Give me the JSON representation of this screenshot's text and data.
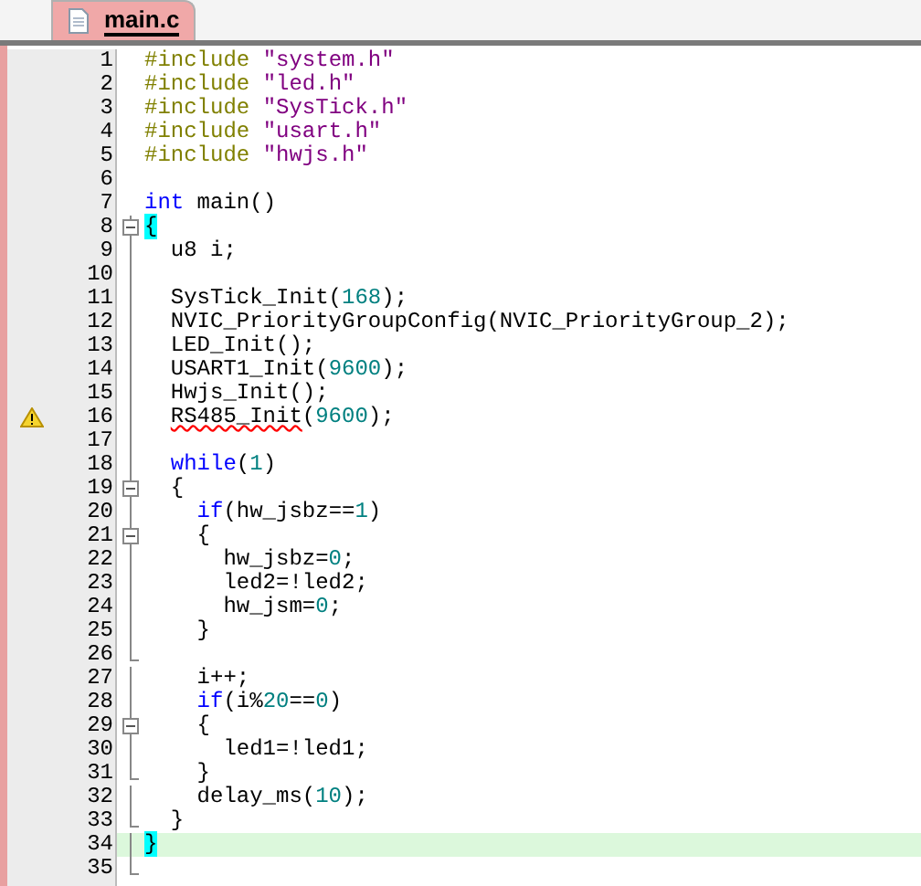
{
  "tabs": [
    {
      "label": "main.c",
      "selected": true
    }
  ],
  "lines": [
    {
      "number": "1",
      "collapsible": false,
      "fold_end": false,
      "warning": false,
      "current": false,
      "segments": [
        {
          "kind": "preprocessor",
          "text": "#include "
        },
        {
          "kind": "string",
          "text": "\"system.h\""
        }
      ]
    },
    {
      "number": "2",
      "collapsible": false,
      "fold_end": false,
      "warning": false,
      "current": false,
      "segments": [
        {
          "kind": "preprocessor",
          "text": "#include "
        },
        {
          "kind": "string",
          "text": "\"led.h\""
        }
      ]
    },
    {
      "number": "3",
      "collapsible": false,
      "fold_end": false,
      "warning": false,
      "current": false,
      "segments": [
        {
          "kind": "preprocessor",
          "text": "#include "
        },
        {
          "kind": "string",
          "text": "\"SysTick.h\""
        }
      ]
    },
    {
      "number": "4",
      "collapsible": false,
      "fold_end": false,
      "warning": false,
      "current": false,
      "segments": [
        {
          "kind": "preprocessor",
          "text": "#include "
        },
        {
          "kind": "string",
          "text": "\"usart.h\""
        }
      ]
    },
    {
      "number": "5",
      "collapsible": false,
      "fold_end": false,
      "warning": false,
      "current": false,
      "segments": [
        {
          "kind": "preprocessor",
          "text": "#include "
        },
        {
          "kind": "string",
          "text": "\"hwjs.h\""
        }
      ]
    },
    {
      "number": "6",
      "collapsible": false,
      "fold_end": false,
      "warning": false,
      "current": false
    },
    {
      "number": "7",
      "collapsible": false,
      "fold_end": false,
      "warning": false,
      "current": false,
      "segments": [
        {
          "kind": "keyword",
          "text": "int"
        },
        {
          "kind": "plain",
          "text": " main()"
        }
      ]
    },
    {
      "number": "8",
      "collapsible": true,
      "fold_end": false,
      "warning": false,
      "current": false,
      "segments": [
        {
          "kind": "brace_match",
          "text": "{"
        }
      ],
      "children": [
        {
          "number": "9",
          "collapsible": false,
          "fold_end": false,
          "warning": false,
          "current": false,
          "segments": [
            {
              "kind": "plain",
              "text": "u8 i;"
            }
          ]
        },
        {
          "number": "10",
          "collapsible": false,
          "fold_end": false,
          "warning": false,
          "current": false
        },
        {
          "number": "11",
          "collapsible": false,
          "fold_end": false,
          "warning": false,
          "current": false,
          "segments": [
            {
              "kind": "plain",
              "text": "SysTick_Init("
            },
            {
              "kind": "number",
              "text": "168"
            },
            {
              "kind": "plain",
              "text": ");"
            }
          ]
        },
        {
          "number": "12",
          "collapsible": false,
          "fold_end": false,
          "warning": false,
          "current": false,
          "segments": [
            {
              "kind": "plain",
              "text": "NVIC_PriorityGroupConfig(NVIC_PriorityGroup_2);"
            }
          ]
        },
        {
          "number": "13",
          "collapsible": false,
          "fold_end": false,
          "warning": false,
          "current": false,
          "segments": [
            {
              "kind": "plain",
              "text": "LED_Init();"
            }
          ]
        },
        {
          "number": "14",
          "collapsible": false,
          "fold_end": false,
          "warning": false,
          "current": false,
          "segments": [
            {
              "kind": "plain",
              "text": "USART1_Init("
            },
            {
              "kind": "number",
              "text": "9600"
            },
            {
              "kind": "plain",
              "text": ");"
            }
          ]
        },
        {
          "number": "15",
          "collapsible": false,
          "fold_end": false,
          "warning": false,
          "current": false,
          "segments": [
            {
              "kind": "plain",
              "text": "Hwjs_Init();"
            }
          ]
        },
        {
          "number": "16",
          "collapsible": false,
          "fold_end": false,
          "warning": true,
          "current": false,
          "segments": [
            {
              "kind": "error",
              "text": "RS485_Init"
            },
            {
              "kind": "plain",
              "text": "("
            },
            {
              "kind": "number",
              "text": "9600"
            },
            {
              "kind": "plain",
              "text": ");"
            }
          ]
        },
        {
          "number": "17",
          "collapsible": false,
          "fold_end": false,
          "warning": false,
          "current": false
        },
        {
          "number": "18",
          "collapsible": false,
          "fold_end": false,
          "warning": false,
          "current": false,
          "segments": [
            {
              "kind": "keyword",
              "text": "while"
            },
            {
              "kind": "plain",
              "text": "("
            },
            {
              "kind": "number",
              "text": "1"
            },
            {
              "kind": "plain",
              "text": ")"
            }
          ]
        },
        {
          "number": "19",
          "collapsible": true,
          "fold_end": false,
          "warning": false,
          "current": false,
          "segments": [
            {
              "kind": "plain",
              "text": "{"
            }
          ],
          "children": [
            {
              "number": "20",
              "collapsible": false,
              "fold_end": false,
              "warning": false,
              "current": false,
              "segments": [
                {
                  "kind": "keyword",
                  "text": "if"
                },
                {
                  "kind": "plain",
                  "text": "(hw_jsbz=="
                },
                {
                  "kind": "number",
                  "text": "1"
                },
                {
                  "kind": "plain",
                  "text": ")"
                }
              ]
            },
            {
              "number": "21",
              "collapsible": true,
              "fold_end": false,
              "warning": false,
              "current": false,
              "segments": [
                {
                  "kind": "plain",
                  "text": "{"
                }
              ],
              "children": [
                {
                  "number": "22",
                  "collapsible": false,
                  "fold_end": false,
                  "warning": false,
                  "current": false,
                  "segments": [
                    {
                      "kind": "plain",
                      "text": "hw_jsbz="
                    },
                    {
                      "kind": "number",
                      "text": "0"
                    },
                    {
                      "kind": "plain",
                      "text": ";"
                    }
                  ]
                },
                {
                  "number": "23",
                  "collapsible": false,
                  "fold_end": false,
                  "warning": false,
                  "current": false,
                  "segments": [
                    {
                      "kind": "plain",
                      "text": "led2=!led2;"
                    }
                  ]
                },
                {
                  "number": "24",
                  "collapsible": false,
                  "fold_end": false,
                  "warning": false,
                  "current": false,
                  "segments": [
                    {
                      "kind": "plain",
                      "text": "hw_jsm="
                    },
                    {
                      "kind": "number",
                      "text": "0"
                    },
                    {
                      "kind": "plain",
                      "text": ";"
                    }
                  ]
                }
              ]
            },
            {
              "number": "25",
              "collapsible": false,
              "fold_end": false,
              "warning": false,
              "current": false,
              "segments": [
                {
                  "kind": "plain",
                  "text": "}"
                }
              ]
            },
            {
              "number": "26",
              "collapsible": false,
              "fold_end": true,
              "warning": false,
              "current": false
            },
            {
              "number": "27",
              "collapsible": false,
              "fold_end": false,
              "warning": false,
              "current": false,
              "segments": [
                {
                  "kind": "plain",
                  "text": "i++;"
                }
              ]
            },
            {
              "number": "28",
              "collapsible": false,
              "fold_end": false,
              "warning": false,
              "current": false,
              "segments": [
                {
                  "kind": "keyword",
                  "text": "if"
                },
                {
                  "kind": "plain",
                  "text": "(i%"
                },
                {
                  "kind": "number",
                  "text": "20"
                },
                {
                  "kind": "plain",
                  "text": "=="
                },
                {
                  "kind": "number",
                  "text": "0"
                },
                {
                  "kind": "plain",
                  "text": ")"
                }
              ]
            },
            {
              "number": "29",
              "collapsible": true,
              "fold_end": false,
              "warning": false,
              "current": false,
              "segments": [
                {
                  "kind": "plain",
                  "text": "{"
                }
              ],
              "children": [
                {
                  "number": "30",
                  "collapsible": false,
                  "fold_end": false,
                  "warning": false,
                  "current": false,
                  "segments": [
                    {
                      "kind": "plain",
                      "text": "led1=!led1;"
                    }
                  ]
                }
              ]
            },
            {
              "number": "31",
              "collapsible": false,
              "fold_end": true,
              "warning": false,
              "current": false,
              "segments": [
                {
                  "kind": "plain",
                  "text": "}"
                }
              ]
            },
            {
              "number": "32",
              "collapsible": false,
              "fold_end": false,
              "warning": false,
              "current": false,
              "segments": [
                {
                  "kind": "plain",
                  "text": "delay_ms("
                },
                {
                  "kind": "number",
                  "text": "10"
                },
                {
                  "kind": "plain",
                  "text": ");"
                }
              ]
            }
          ]
        },
        {
          "number": "33",
          "collapsible": false,
          "fold_end": true,
          "warning": false,
          "current": false,
          "segments": [
            {
              "kind": "plain",
              "text": "}"
            }
          ]
        }
      ]
    },
    {
      "number": "34",
      "collapsible": false,
      "fold_end": false,
      "warning": false,
      "current": true,
      "segments": [
        {
          "kind": "brace_match",
          "text": "}"
        }
      ]
    },
    {
      "number": "35",
      "collapsible": false,
      "fold_end": true,
      "warning": false,
      "current": false
    }
  ]
}
